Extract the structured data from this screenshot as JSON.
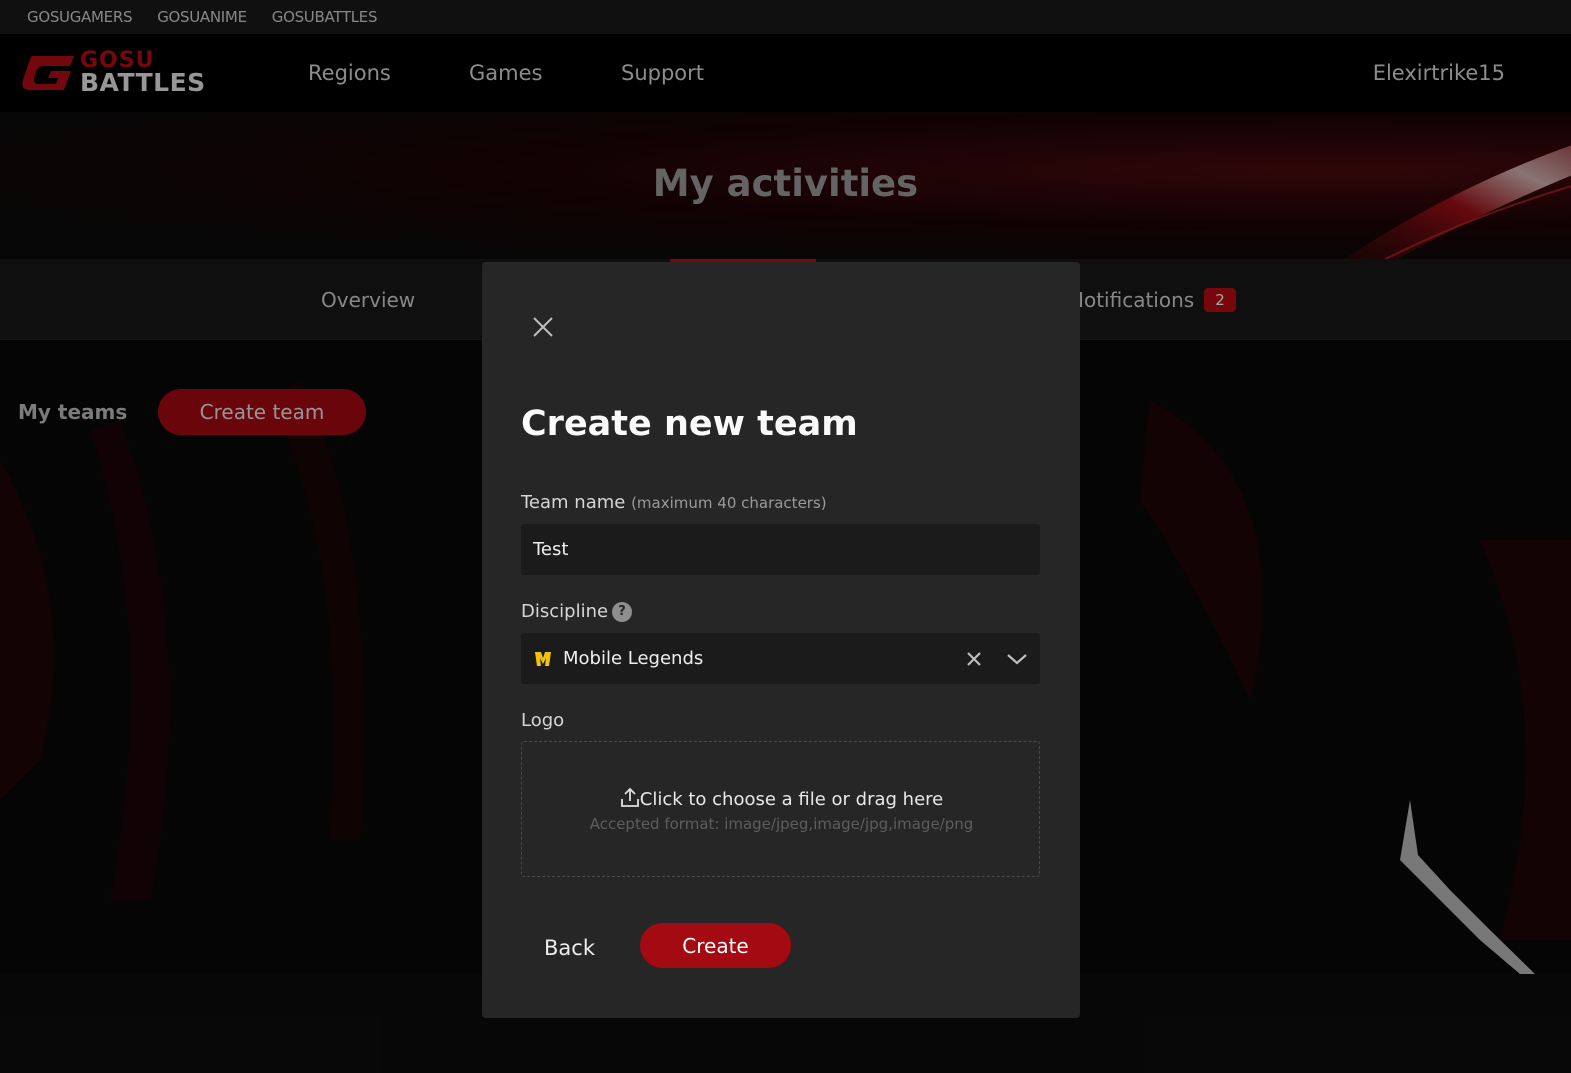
{
  "top_links": [
    "GOSUGAMERS",
    "GOSUANIME",
    "GOSUBATTLES"
  ],
  "logo": {
    "line1": "GOSU",
    "line2": "BATTLES"
  },
  "nav": {
    "regions": "Regions",
    "games": "Games",
    "support": "Support"
  },
  "user": {
    "name": "Elexirtrike15"
  },
  "hero": {
    "title": "My activities"
  },
  "tabs": {
    "overview": "Overview",
    "notifications": "Notifications",
    "notifications_count": "2"
  },
  "teams": {
    "heading": "My teams",
    "create_button": "Create team"
  },
  "modal": {
    "title": "Create new team",
    "team_name_label": "Team name",
    "team_name_hint": "(maximum 40 characters)",
    "team_name_value": "Test",
    "discipline_label": "Discipline",
    "discipline_help": "?",
    "discipline_value": "Mobile Legends",
    "logo_label": "Logo",
    "upload_text": "Click to choose a file or drag here",
    "upload_formats": "Accepted format: image/jpeg,image/jpg,image/png",
    "back_label": "Back",
    "create_label": "Create"
  },
  "colors": {
    "accent": "#a30a11",
    "badge": "#b50d14",
    "modal_bg": "#262626"
  }
}
